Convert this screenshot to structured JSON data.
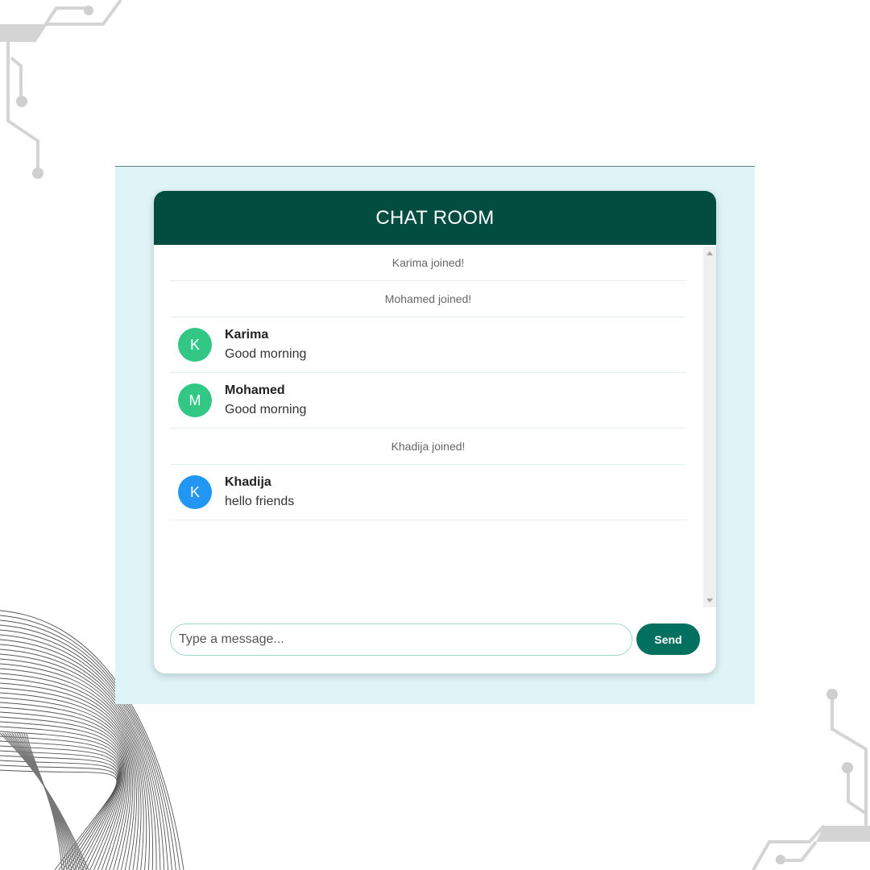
{
  "chat": {
    "title": "CHAT ROOM",
    "messages": [
      {
        "kind": "system",
        "text": "Karima joined!"
      },
      {
        "kind": "system",
        "text": "Mohamed joined!"
      },
      {
        "kind": "message",
        "initial": "K",
        "user": "Karima",
        "text": "Good morning",
        "avatar_color": "#32c785"
      },
      {
        "kind": "message",
        "initial": "M",
        "user": "Mohamed",
        "text": "Good morning",
        "avatar_color": "#32c785"
      },
      {
        "kind": "system",
        "text": "Khadija joined!"
      },
      {
        "kind": "message",
        "initial": "K",
        "user": "Khadija",
        "text": "hello friends",
        "avatar_color": "#2196f3"
      }
    ]
  },
  "composer": {
    "placeholder": "Type a message...",
    "value": "",
    "send_label": "Send"
  },
  "colors": {
    "header_bg": "#024d40",
    "send_button": "#02705f",
    "page_frame_bg": "#dff4f7"
  }
}
